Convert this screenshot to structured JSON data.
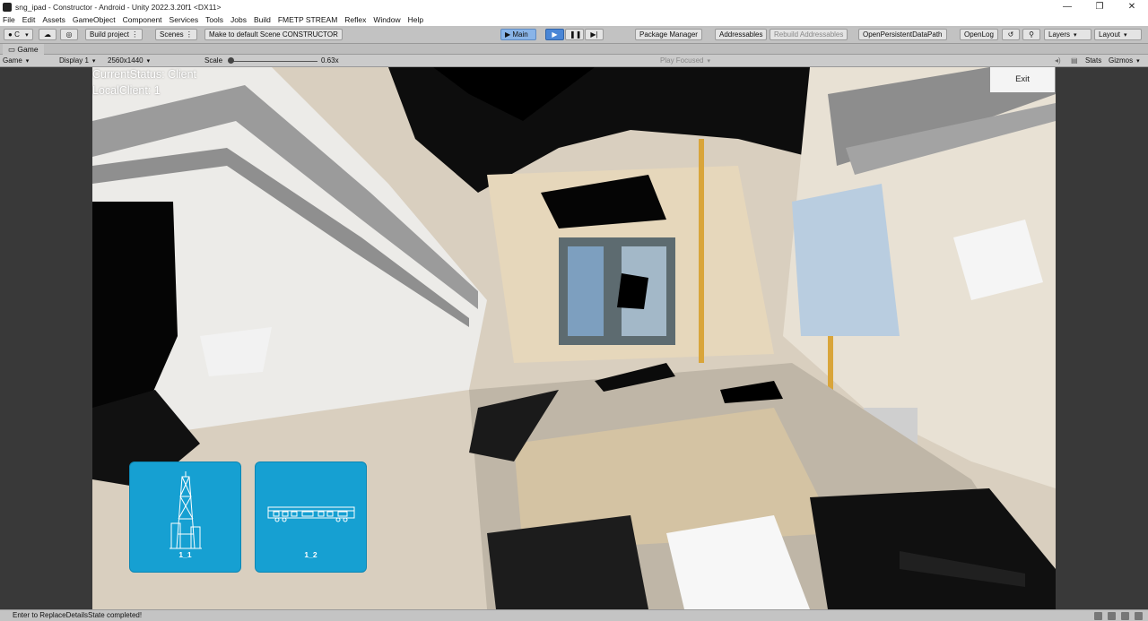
{
  "window": {
    "title": "sng_ipad - Constructor - Android - Unity 2022.3.20f1 <DX11>",
    "controls": [
      "—",
      "❐",
      "✕"
    ]
  },
  "menu": [
    "File",
    "Edit",
    "Assets",
    "GameObject",
    "Component",
    "Services",
    "Tools",
    "Jobs",
    "Build",
    "FMETP STREAM",
    "Reflex",
    "Window",
    "Help"
  ],
  "toolbar": {
    "account": "C",
    "build_project": "Build project",
    "scenes": "Scenes",
    "make_default": "Make to default Scene CONSTRUCTOR",
    "main": "▶ Main",
    "package_manager": "Package Manager",
    "addressables": "Addressables",
    "rebuild_addressables": "Rebuild Addressables",
    "open_persistent": "OpenPersistentDataPath",
    "open_log": "OpenLog",
    "layers": "Layers",
    "layout": "Layout"
  },
  "tab": {
    "label": "Game"
  },
  "gamebar": {
    "mode": "Game",
    "display": "Display 1",
    "resolution": "2560x1440",
    "scale_label": "Scale",
    "scale_value": "0.63x",
    "play_focused": "Play Focused",
    "stats": "Stats",
    "gizmos": "Gizmos"
  },
  "hud": {
    "status": "CurrentStatus: Client",
    "local_client": "LocalClient: 1",
    "exit": "Exit"
  },
  "cards": [
    {
      "label": "1_1",
      "icon": "drilling-rig-icon"
    },
    {
      "label": "1_2",
      "icon": "train-car-icon"
    }
  ],
  "status_bar": {
    "message": "Enter to ReplaceDetailsState completed!"
  }
}
